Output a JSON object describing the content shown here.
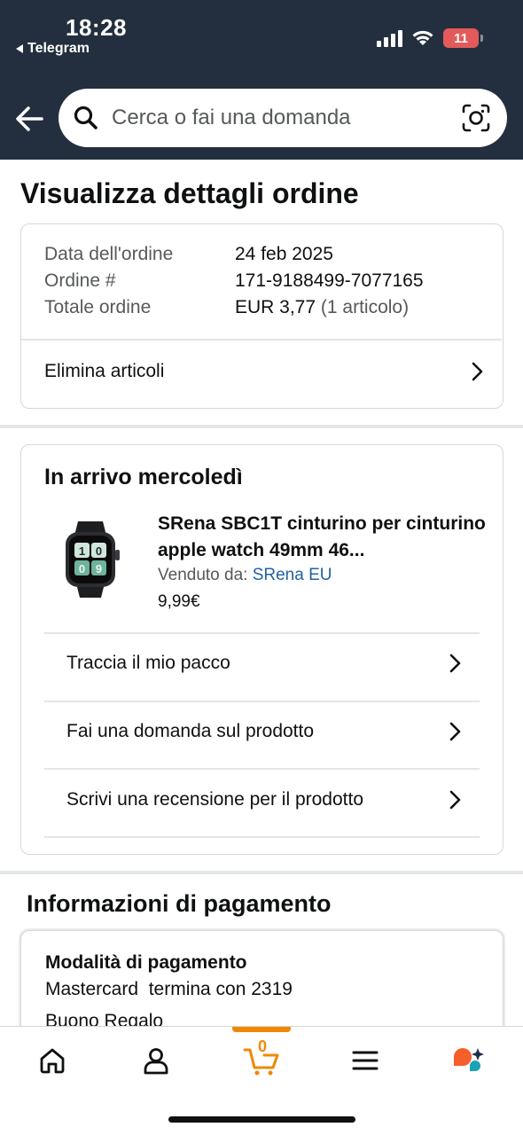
{
  "status_bar": {
    "time": "18:28",
    "back_app": "Telegram",
    "battery": "11"
  },
  "header": {
    "search_placeholder": "Cerca o fai una domanda"
  },
  "page": {
    "title": "Visualizza dettagli ordine"
  },
  "order_summary": {
    "date_label": "Data dell'ordine",
    "date_value": "24 feb 2025",
    "order_label": "Ordine #",
    "order_value": "171-9188499-7077165",
    "total_label": "Totale ordine",
    "total_value": "EUR 3,77",
    "total_items": "(1 articolo)",
    "delete_items": "Elimina articoli"
  },
  "shipment": {
    "title": "In arrivo mercoledì",
    "product_title": "SRena SBC1T cinturino per cinturino apple watch 49mm 46...",
    "sold_by_label": "Venduto da:",
    "seller": "SRena EU",
    "price": "9,99€",
    "actions": [
      "Traccia il mio pacco",
      "Fai una domanda sul prodotto",
      "Scrivi una recensione per il prodotto"
    ]
  },
  "payment": {
    "section_title": "Informazioni di pagamento",
    "method_label": "Modalità di pagamento",
    "method_value": "Mastercard  termina con 2319",
    "gift_card": "Buono Regalo"
  },
  "bottom_nav": {
    "cart_count": "0",
    "items": [
      "home-icon",
      "account-icon",
      "cart-icon",
      "menu-icon",
      "rufus-icon"
    ]
  },
  "colors": {
    "header_bg": "#232f3e",
    "link": "#2162a1",
    "cart_accent": "#f08804"
  }
}
